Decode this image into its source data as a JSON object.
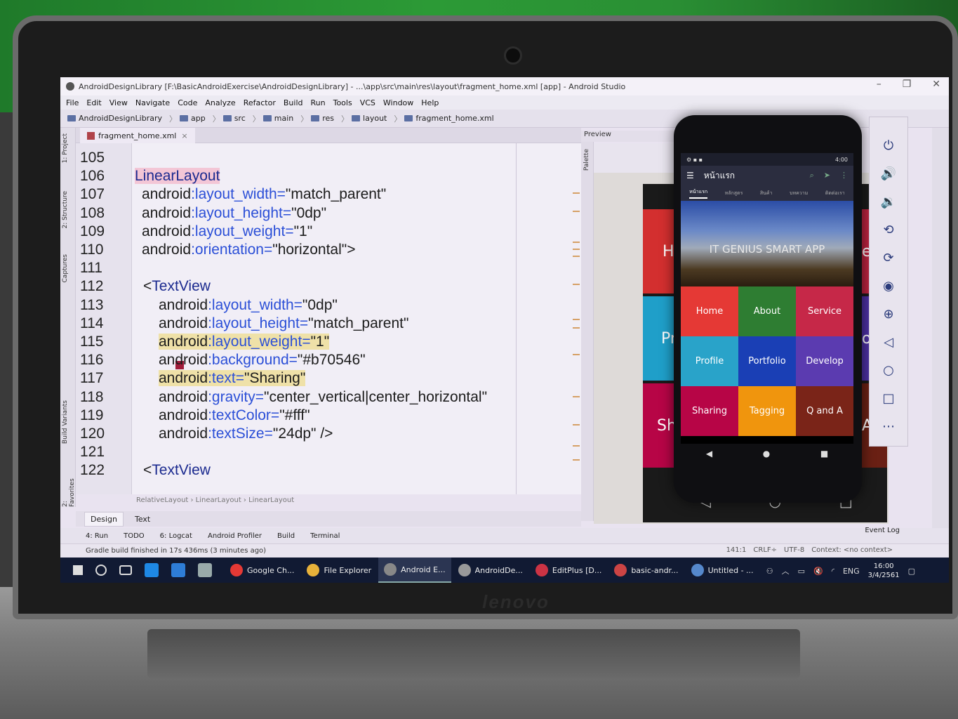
{
  "window": {
    "title": "AndroidDesignLibrary [F:\\BasicAndroidExercise\\AndroidDesignLibrary] - ...\\app\\src\\main\\res\\layout\\fragment_home.xml [app] - Android Studio"
  },
  "menu": [
    "File",
    "Edit",
    "View",
    "Navigate",
    "Code",
    "Analyze",
    "Refactor",
    "Build",
    "Run",
    "Tools",
    "VCS",
    "Window",
    "Help"
  ],
  "breadcrumbs": [
    "AndroidDesignLibrary",
    "app",
    "src",
    "main",
    "res",
    "layout",
    "fragment_home.xml"
  ],
  "left_tool_tabs": [
    "1: Project",
    "2: Structure",
    "Captures",
    "Build Variants",
    "2: Favorites"
  ],
  "editor": {
    "file_tab": "fragment_home.xml",
    "lines": [
      {
        "n": "105",
        "parts": []
      },
      {
        "n": "106",
        "parts": [
          {
            "t": "LinearLayout",
            "c": "tag hl-pink"
          }
        ]
      },
      {
        "n": "107",
        "parts": [
          {
            "t": "android",
            "c": "ns"
          },
          {
            "t": ":layout_width=",
            "c": "attr"
          },
          {
            "t": "\"match_parent\"",
            "c": "plain"
          }
        ]
      },
      {
        "n": "108",
        "parts": [
          {
            "t": "android",
            "c": "ns"
          },
          {
            "t": ":layout_height=",
            "c": "attr"
          },
          {
            "t": "\"0dp\"",
            "c": "plain"
          }
        ]
      },
      {
        "n": "109",
        "parts": [
          {
            "t": "android",
            "c": "ns"
          },
          {
            "t": ":layout_weight=",
            "c": "attr"
          },
          {
            "t": "\"1\"",
            "c": "plain"
          }
        ]
      },
      {
        "n": "110",
        "parts": [
          {
            "t": "android",
            "c": "ns"
          },
          {
            "t": ":orientation=",
            "c": "attr"
          },
          {
            "t": "\"horizontal\">",
            "c": "plain"
          }
        ]
      },
      {
        "n": "111",
        "parts": []
      },
      {
        "n": "112",
        "parts": [
          {
            "t": "<",
            "c": "plain"
          },
          {
            "t": "TextView",
            "c": "tag"
          }
        ]
      },
      {
        "n": "113",
        "parts": [
          {
            "t": "android",
            "c": "ns"
          },
          {
            "t": ":layout_width=",
            "c": "attr"
          },
          {
            "t": "\"0dp\"",
            "c": "plain"
          }
        ]
      },
      {
        "n": "114",
        "parts": [
          {
            "t": "android",
            "c": "ns"
          },
          {
            "t": ":layout_height=",
            "c": "attr"
          },
          {
            "t": "\"match_parent\"",
            "c": "plain"
          }
        ]
      },
      {
        "n": "115",
        "parts": [
          {
            "t": "android",
            "c": "ns hl-yellow"
          },
          {
            "t": ":layout_weight=",
            "c": "attr hl-yellow"
          },
          {
            "t": "\"1\"",
            "c": "plain hl-yellow"
          }
        ]
      },
      {
        "n": "116",
        "parts": [
          {
            "t": "android",
            "c": "ns"
          },
          {
            "t": ":background=",
            "c": "attr"
          },
          {
            "t": "\"#b70546\"",
            "c": "plain"
          }
        ]
      },
      {
        "n": "117",
        "parts": [
          {
            "t": "android",
            "c": "ns hl-yellow"
          },
          {
            "t": ":text=",
            "c": "attr hl-yellow"
          },
          {
            "t": "\"Sharing\"",
            "c": "plain hl-yellow"
          }
        ]
      },
      {
        "n": "118",
        "parts": [
          {
            "t": "android",
            "c": "ns"
          },
          {
            "t": ":gravity=",
            "c": "attr"
          },
          {
            "t": "\"center_vertical|center_horizontal\"",
            "c": "plain"
          }
        ]
      },
      {
        "n": "119",
        "parts": [
          {
            "t": "android",
            "c": "ns"
          },
          {
            "t": ":textColor=",
            "c": "attr"
          },
          {
            "t": "\"#fff\"",
            "c": "plain"
          }
        ]
      },
      {
        "n": "120",
        "parts": [
          {
            "t": "android",
            "c": "ns"
          },
          {
            "t": ":textSize=",
            "c": "attr"
          },
          {
            "t": "\"24dp\"",
            "c": "plain"
          },
          {
            "t": " />",
            "c": "plain"
          }
        ]
      },
      {
        "n": "121",
        "parts": []
      },
      {
        "n": "122",
        "parts": [
          {
            "t": "<",
            "c": "plain"
          },
          {
            "t": "TextView",
            "c": "tag"
          }
        ]
      }
    ],
    "bottom_breadcrumb": "RelativeLayout  ›  LinearLayout  ›  LinearLayout",
    "view_tabs": [
      "Design",
      "Text"
    ],
    "active_view_tab": "Design"
  },
  "tool_windows": [
    "4: Run",
    "TODO",
    "6: Logcat",
    "Android Profiler",
    "Build",
    "Terminal"
  ],
  "event_log": "Event Log",
  "status": {
    "message": "Gradle build finished in 17s 436ms (3 minutes ago)",
    "position": "141:1",
    "line_sep": "CRLF÷",
    "encoding": "UTF-8",
    "context": "Context: <no context>"
  },
  "preview": {
    "header": "Preview",
    "palette_label": "Palette",
    "blueprint_letters": [
      "H",
      "Pr",
      "Sh",
      "e",
      "op",
      "A"
    ]
  },
  "emulator": {
    "time": "4:00",
    "app_title": "หน้าแรก",
    "tabs": [
      "หน้าแรก",
      "หลักสูตร",
      "สินค้า",
      "บทความ",
      "ติดต่อเรา"
    ],
    "banner_title": "IT GENIUS SMART APP",
    "cells": [
      {
        "label": "Home",
        "color": "#e53935"
      },
      {
        "label": "About",
        "color": "#2e7d32"
      },
      {
        "label": "Service",
        "color": "#c62848"
      },
      {
        "label": "Profile",
        "color": "#29a3c9"
      },
      {
        "label": "Portfolio",
        "color": "#1a3fb5"
      },
      {
        "label": "Develop",
        "color": "#5b3bb0"
      },
      {
        "label": "Sharing",
        "color": "#b70546"
      },
      {
        "label": "Tagging",
        "color": "#f0950d"
      },
      {
        "label": "Q and A",
        "color": "#7a2418"
      }
    ]
  },
  "taskbar": {
    "apps": [
      "Google Ch...",
      "File Explorer",
      "Android E...",
      "AndroidDe...",
      "EditPlus [D...",
      "basic-andr...",
      "Untitled - ..."
    ],
    "active_app": "Android E...",
    "language": "ENG",
    "time": "16:00",
    "date": "3/4/2561"
  },
  "brand": "lenovo",
  "colors": {
    "accent_red": "#b70546",
    "taskbar": "#111a33"
  }
}
